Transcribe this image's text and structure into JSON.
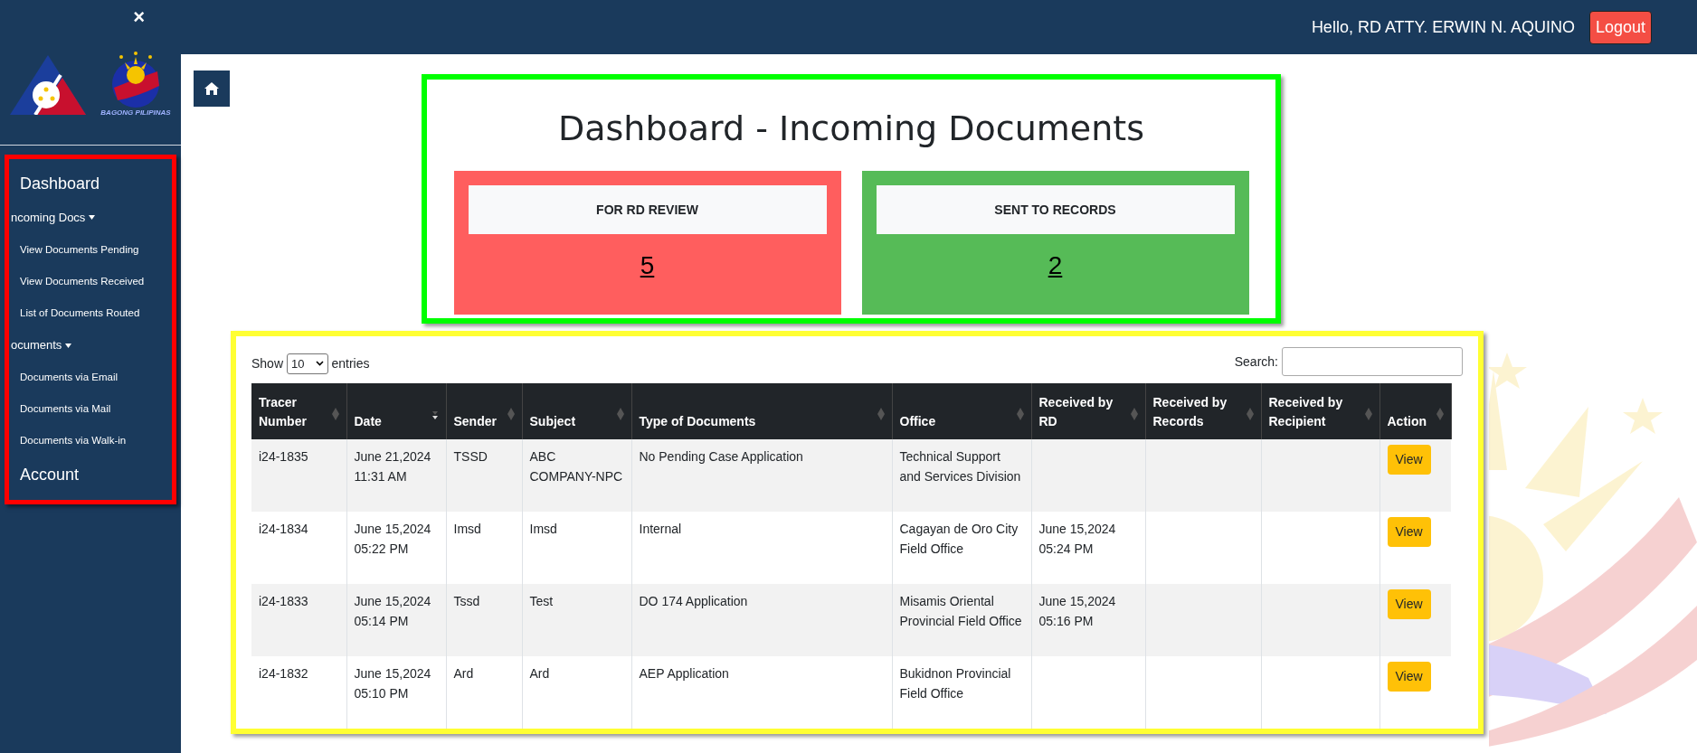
{
  "header": {
    "greeting": "Hello, RD ATTY. ERWIN N. AQUINO",
    "logout": "Logout"
  },
  "sidebar": {
    "close": "×",
    "logo_caption": "BAGONG PILIPINAS",
    "nav": [
      {
        "label": "Dashboard",
        "kind": "link"
      },
      {
        "label": "ncoming Docs",
        "kind": "group",
        "expanded": true,
        "children": [
          {
            "label": "View Documents Pending"
          },
          {
            "label": "View Documents Received"
          },
          {
            "label": "List of Documents Routed"
          }
        ]
      },
      {
        "label": "ocuments",
        "kind": "group",
        "expanded": true,
        "children": [
          {
            "label": "Documents via Email"
          },
          {
            "label": "Documents via Mail"
          },
          {
            "label": "Documents via Walk-in"
          }
        ]
      },
      {
        "label": "Account",
        "kind": "link"
      }
    ]
  },
  "dashboard": {
    "title": "Dashboard - Incoming Documents",
    "cards": [
      {
        "label": "FOR RD REVIEW",
        "count": "5",
        "color": "#ff5e5e"
      },
      {
        "label": "SENT TO RECORDS",
        "count": "2",
        "color": "#56bb57"
      }
    ]
  },
  "table": {
    "show_label": "Show",
    "page_size": "10",
    "entries_label": "entries",
    "search_label": "Search:",
    "columns": [
      {
        "label": "Tracer Number",
        "sorted_descending": false
      },
      {
        "label": "Date",
        "sorted_descending": true
      },
      {
        "label": "Sender",
        "sorted_descending": false
      },
      {
        "label": "Subject",
        "sorted_descending": false
      },
      {
        "label": "Type of Documents",
        "sorted_descending": false
      },
      {
        "label": "Office",
        "sorted_descending": false
      },
      {
        "label": "Received by RD",
        "sorted_descending": false
      },
      {
        "label": "Received by Records",
        "sorted_descending": false
      },
      {
        "label": "Received by Recipient",
        "sorted_descending": false
      },
      {
        "label": "Action",
        "sorted_descending": false
      }
    ],
    "rows": [
      {
        "cells": [
          "i24-1835",
          "June 21,2024 11:31 AM",
          "TSSD",
          "ABC COMPANY-NPC",
          "No Pending Case Application",
          "Technical Support and Services Division",
          "",
          "",
          ""
        ],
        "action": "View"
      },
      {
        "cells": [
          "i24-1834",
          "June 15,2024 05:22 PM",
          "Imsd",
          "Imsd",
          "Internal",
          "Cagayan de Oro City Field Office",
          "June 15,2024 05:24 PM",
          "",
          ""
        ],
        "action": "View"
      },
      {
        "cells": [
          "i24-1833",
          "June 15,2024 05:14 PM",
          "Tssd",
          "Test",
          "DO 174 Application",
          "Misamis Oriental Provincial Field Office",
          "June 15,2024 05:16 PM",
          "",
          ""
        ],
        "action": "View"
      },
      {
        "cells": [
          "i24-1832",
          "June 15,2024 05:10 PM",
          "Ard",
          "Ard",
          "AEP Application",
          "Bukidnon Provincial Field Office",
          "",
          "",
          ""
        ],
        "action": "View"
      }
    ]
  }
}
